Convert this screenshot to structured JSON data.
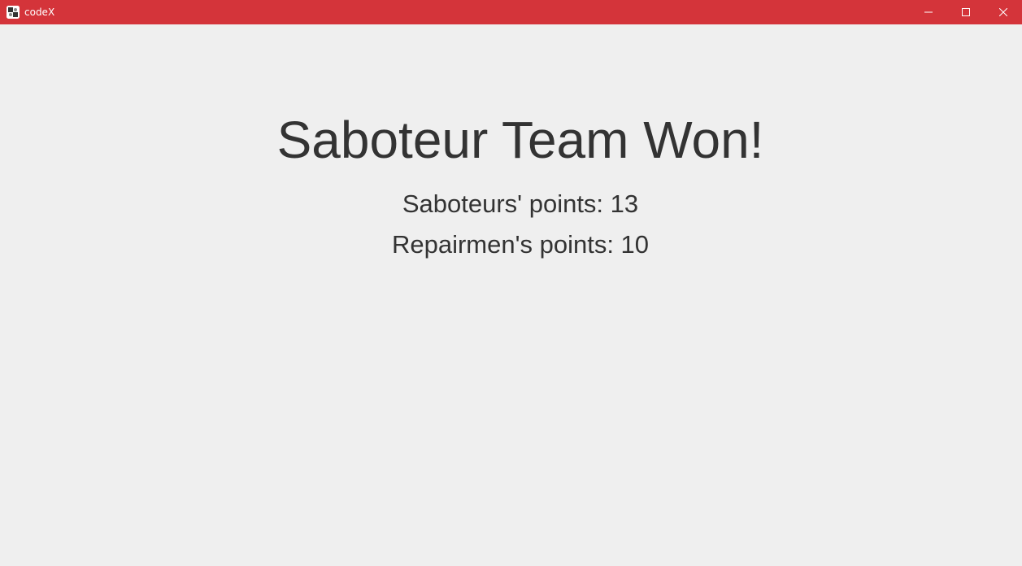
{
  "window": {
    "title": "codeX",
    "accent_color": "#d4343a",
    "app_icon": "game-app-icon",
    "controls": {
      "minimize_icon": "minimize-icon",
      "maximize_icon": "maximize-icon",
      "close_icon": "close-icon"
    }
  },
  "result": {
    "headline": "Saboteur Team Won!",
    "saboteurs_points": "Saboteurs' points: 13",
    "repairmen_points": "Repairmen's points: 10"
  }
}
